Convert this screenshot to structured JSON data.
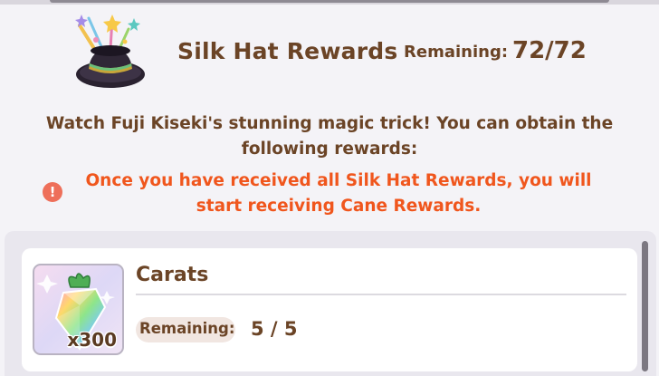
{
  "header": {
    "title": "Silk Hat Rewards",
    "remaining_label": "Remaining:",
    "remaining_value": "72/72",
    "icon": "magic-silk-hat-icon"
  },
  "description": "Watch Fuji Kiseki's stunning magic trick! You can obtain the following rewards:",
  "warning": {
    "icon": "exclamation-icon",
    "icon_glyph": "!",
    "text": "Once you have received all Silk Hat Rewards, you will start receiving Cane Rewards."
  },
  "rewards": [
    {
      "name": "Carats",
      "icon": "carat-crystal-icon",
      "quantity": "x300",
      "remaining_label": "Remaining:",
      "remaining_value": "5 / 5"
    }
  ],
  "colors": {
    "text_brown": "#6b4426",
    "warning_orange": "#f0561d",
    "warning_icon": "#ee6f5a",
    "background": "#f4f3f7",
    "panel": "#e9e7ee"
  }
}
